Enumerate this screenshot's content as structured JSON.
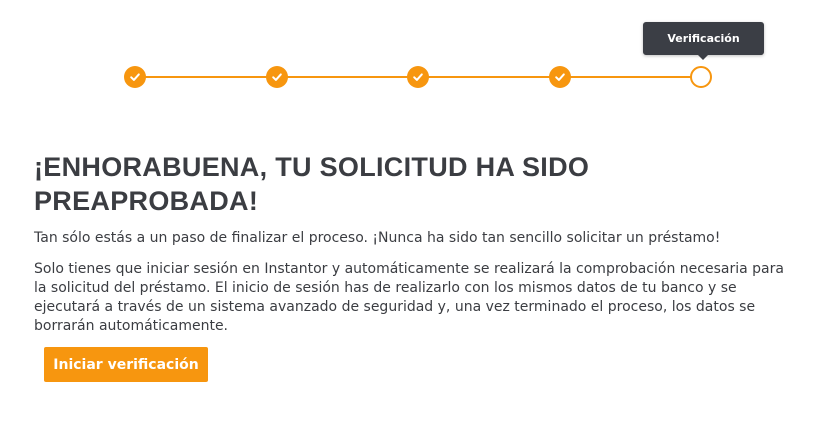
{
  "stepper": {
    "steps": [
      {
        "status": "done",
        "icon": "check-icon"
      },
      {
        "status": "done",
        "icon": "check-icon"
      },
      {
        "status": "done",
        "icon": "check-icon"
      },
      {
        "status": "done",
        "icon": "check-icon"
      },
      {
        "status": "current",
        "icon": "empty-circle-icon"
      }
    ],
    "tooltip": "Verificación",
    "accent_color": "#f7960f"
  },
  "main": {
    "title": "¡ENHORABUENA, TU SOLICITUD HA SIDO PREAPROBADA!",
    "lead": "Tan sólo estás a un paso de finalizar el proceso. ¡Nunca ha sido tan sencillo solicitar un préstamo!",
    "body": "Solo tienes que iniciar sesión en Instantor y automáticamente se realizará la comprobación necesaria para la solicitud del préstamo. El inicio de sesión has de realizarlo con los mismos datos de tu banco y se ejecutará a través de un sistema avanzado de seguridad y, una vez terminado el proceso, los datos se borrarán automáticamente.",
    "cta_label": "Iniciar verificación"
  }
}
